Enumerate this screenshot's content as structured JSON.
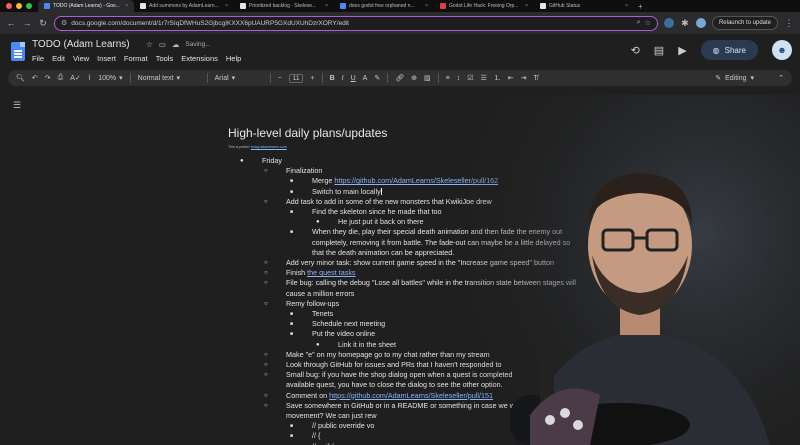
{
  "tabs": [
    {
      "title": "TODO (Adam Learns) - Goo...",
      "color": "#4a8af4",
      "active": true
    },
    {
      "title": "Add summons by AdamLearn...",
      "color": "#e6e6e6",
      "active": false
    },
    {
      "title": "Prioritized backlog · Skelese...",
      "color": "#e6e6e6",
      "active": false
    },
    {
      "title": "does godot free orphaned n...",
      "color": "#4a8af4",
      "active": false
    },
    {
      "title": "Godot Life Hack: Freeing Orp...",
      "color": "#e04040",
      "active": false
    },
    {
      "title": "GitHub Status",
      "color": "#e6e6e6",
      "active": false
    }
  ],
  "address": {
    "url": "docs.google.com/document/d/1r7rSIqDfWHuS2GjbcgIKXXX6pUAURP5GXdUXUhDzrXORY/edit",
    "relaunch_label": "Relaunch to update"
  },
  "doc": {
    "title": "TODO (Adam Learns)",
    "saving": "Saving...",
    "menu": [
      "File",
      "Edit",
      "View",
      "Insert",
      "Format",
      "Tools",
      "Extensions",
      "Help"
    ],
    "share_label": "Share"
  },
  "toolbar": {
    "zoom": "100%",
    "style": "Normal text",
    "font": "Arial",
    "size": "11",
    "mode": "Editing"
  },
  "content": {
    "heading": "High-level daily plans/updates",
    "subnote_prefix": "This is public!",
    "subnote_link": "today.adamlearns.com",
    "lines": [
      {
        "level": 0,
        "bullet": "●",
        "text": "Friday"
      },
      {
        "level": 1,
        "bullet": "○",
        "text": "Finalization"
      },
      {
        "level": 2,
        "bullet": "■",
        "text": "Merge ",
        "link": "https://github.com/AdamLearns/Skeleseller/pull/162"
      },
      {
        "level": 2,
        "bullet": "■",
        "text": "Switch to main locally",
        "cursor": true
      },
      {
        "level": 1,
        "bullet": "○",
        "text": "Add task to add in some of the new monsters that KwikiJoe drew"
      },
      {
        "level": 2,
        "bullet": "■",
        "text": "Find the skeleton since he made that too"
      },
      {
        "level": 3,
        "bullet": "●",
        "text": "He just put it back on there"
      },
      {
        "level": 2,
        "bullet": "■",
        "text": "When they die, play their special death animation and then fade the enemy out"
      },
      {
        "level": 2,
        "bullet": "",
        "text": "completely, removing it from battle. The fade-out can maybe be a little delayed so"
      },
      {
        "level": 2,
        "bullet": "",
        "text": "that the death animation can be appreciated."
      },
      {
        "level": 1,
        "bullet": "○",
        "text": "Add very minor task: show current game speed in the \"Increase game speed\" button"
      },
      {
        "level": 1,
        "bullet": "○",
        "text": "Finish ",
        "link": "the quest tasks"
      },
      {
        "level": 1,
        "bullet": "○",
        "text": "File bug: calling the debug \"Lose all battles\" while in the transition state between stages will"
      },
      {
        "level": 1,
        "bullet": "",
        "text": "cause a million errors"
      },
      {
        "level": 1,
        "bullet": "○",
        "text": "Remy follow-ups"
      },
      {
        "level": 2,
        "bullet": "■",
        "text": "Tenets"
      },
      {
        "level": 2,
        "bullet": "■",
        "text": "Schedule next meeting"
      },
      {
        "level": 2,
        "bullet": "■",
        "text": "Put the video online"
      },
      {
        "level": 3,
        "bullet": "●",
        "text": "Link it in the sheet"
      },
      {
        "level": 1,
        "bullet": "○",
        "text": "Make \"e\" on my homepage go to my chat rather than my stream"
      },
      {
        "level": 1,
        "bullet": "○",
        "text": "Look through GitHub for issues and PRs that I haven't responded to"
      },
      {
        "level": 1,
        "bullet": "○",
        "text": "Small bug: if you have the shop dialog open when a quest is completed"
      },
      {
        "level": 1,
        "bullet": "",
        "text": "available quest, you have to close the dialog to see the other option."
      },
      {
        "level": 1,
        "bullet": "○",
        "text": "Comment on ",
        "link": "https://github.com/AdamLearns/Skeleseller/pull/151"
      },
      {
        "level": 1,
        "bullet": "○",
        "text": "Save somewhere in GitHub or in a README or something in case we want mu"
      },
      {
        "level": 1,
        "bullet": "",
        "text": "movement? We can just rew"
      },
      {
        "level": 2,
        "bullet": "■",
        "text": "// public override vo"
      },
      {
        "level": 2,
        "bullet": "■",
        "text": "// {"
      },
      {
        "level": 2,
        "bullet": "■",
        "text": "//     if ("
      }
    ]
  }
}
